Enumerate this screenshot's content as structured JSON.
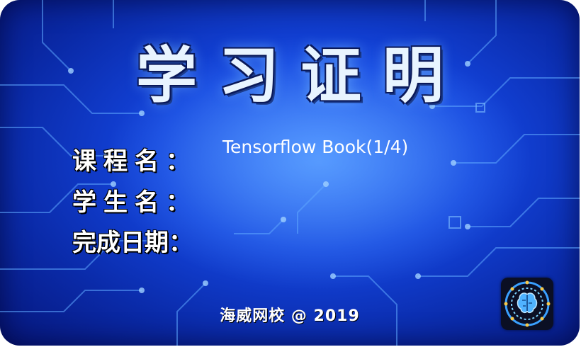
{
  "title": "学习证明",
  "labels": {
    "course": "课程名：",
    "student": "学生名：",
    "date": "完成日期："
  },
  "course_value": "Tensorflow Book(1/4)",
  "footer": "海威网校 @ 2019",
  "logo_icon": "brain-circuit-icon",
  "colors": {
    "background": "#1446e0",
    "title": "#e8f4ff",
    "text": "#ffffff"
  }
}
